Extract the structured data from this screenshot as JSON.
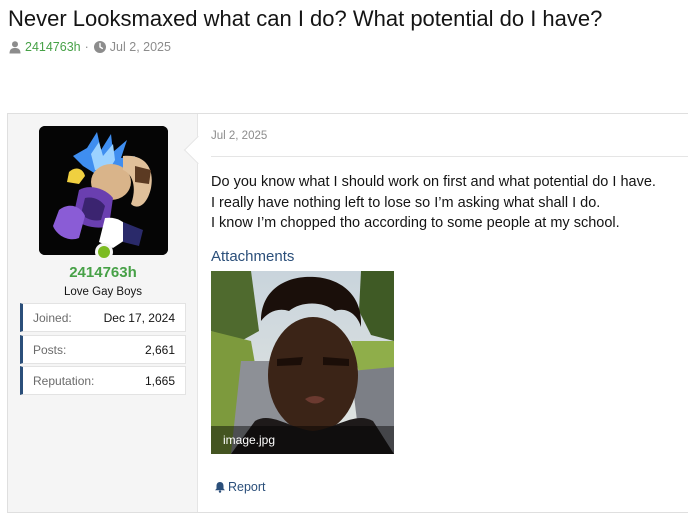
{
  "thread": {
    "title": "Never Looksmaxed what can I do? What potential do I have?",
    "author": "2414763h",
    "date": "Jul 2, 2025"
  },
  "post": {
    "date": "Jul 2, 2025",
    "body": [
      "Do you know what I should work on first and what potential do I have.",
      "I really have nothing left to lose so I’m asking what shall I do.",
      "I know I’m chopped tho according to some people at my school."
    ],
    "attachments_heading": "Attachments",
    "attachment_name": "image.jpg",
    "report_label": "Report"
  },
  "user": {
    "username": "2414763h",
    "title": "Love Gay Boys",
    "stats": [
      {
        "label": "Joined:",
        "value": "Dec 17, 2024"
      },
      {
        "label": "Posts:",
        "value": "2,661"
      },
      {
        "label": "Reputation:",
        "value": "1,665"
      }
    ],
    "online": true
  },
  "icons": {
    "author": "user-icon",
    "date": "clock-icon",
    "report": "bell-icon"
  },
  "colors": {
    "username": "#47a147",
    "accent": "#2b4f7a",
    "online": "#7cbb22"
  }
}
